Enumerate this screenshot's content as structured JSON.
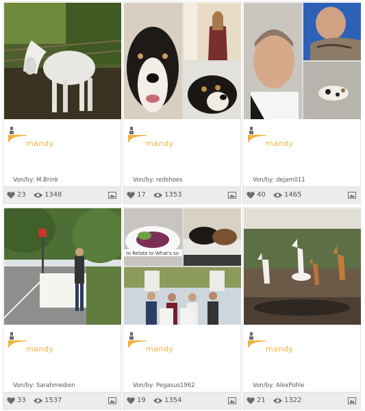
{
  "cards": [
    {
      "user": "mandy",
      "by_label": "Von/by:",
      "author": "M.Brink",
      "likes": "23",
      "views": "1348"
    },
    {
      "user": "mandy",
      "by_label": "Von/by:",
      "author": "redshoes",
      "likes": "17",
      "views": "1353"
    },
    {
      "user": "mandy",
      "by_label": "Von/by:",
      "author": "dejam011",
      "likes": "40",
      "views": "1465"
    },
    {
      "user": "mandy",
      "by_label": "Von/by:",
      "author": "Sarahmedien",
      "likes": "33",
      "views": "1537"
    },
    {
      "user": "mandy",
      "by_label": "Von/by:",
      "author": "Pegasus1962",
      "likes": "19",
      "views": "1354"
    },
    {
      "user": "mandy",
      "by_label": "Von/by:",
      "author": "AlexPohle",
      "likes": "21",
      "views": "1322"
    }
  ],
  "photo_text": {
    "banner": "to Relate to What's so"
  },
  "colors": {
    "user_name": "#f2b13c",
    "stats_bg": "#ececec",
    "icon_gray": "#6b6b6b"
  },
  "icons": {
    "like": "heart-icon",
    "views": "eye-icon",
    "gallery": "image-gallery-icon",
    "user": "user-avatar-icon"
  }
}
